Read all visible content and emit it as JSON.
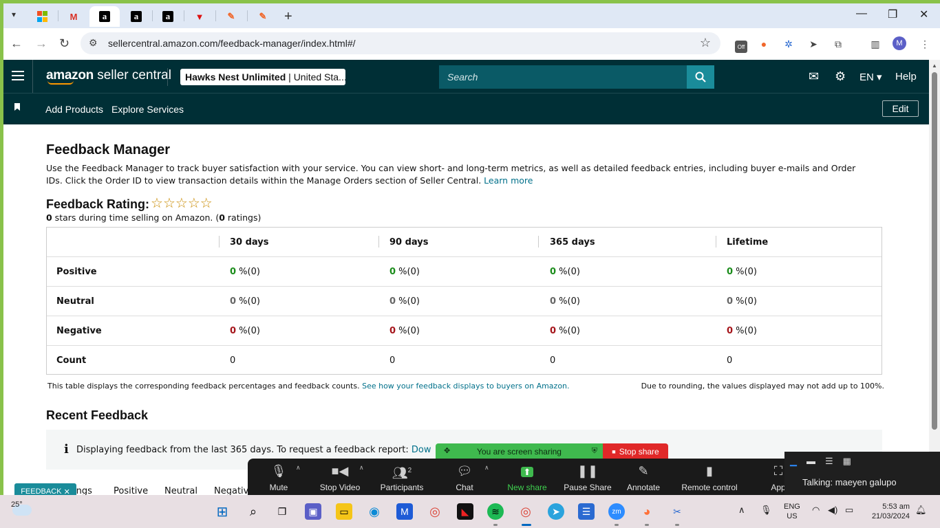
{
  "browser": {
    "url": "sellercentral.amazon.com/feedback-manager/index.html#/",
    "profile_initial": "M",
    "ext_off_label": "Off"
  },
  "header": {
    "logo_bold": "amazon",
    "logo_rest": " seller central",
    "account_name": "Hawks Nest Unlimited",
    "account_region": "United Sta...",
    "search_placeholder": "Search",
    "language": "EN",
    "help": "Help"
  },
  "subnav": {
    "links": [
      "Add Products",
      "Explore Services"
    ],
    "edit": "Edit"
  },
  "main": {
    "title": "Feedback Manager",
    "description": "Use the Feedback Manager to track buyer satisfaction with your service. You can view short- and long-term metrics, as well as detailed feedback entries, including buyer e-mails and Order IDs. Click the Order ID to view transaction details within the Manage Orders section of Seller Central.",
    "learn_more": "Learn more",
    "rating_title": "Feedback Rating:",
    "rating_stars": 0,
    "rating_sub_value": "0",
    "rating_sub_middle": " stars during time selling on Amazon. (",
    "rating_sub_count": "0",
    "rating_sub_end": " ratings)",
    "table": {
      "columns": [
        "30 days",
        "90 days",
        "365 days",
        "Lifetime"
      ],
      "rows": [
        {
          "label": "Positive",
          "type": "pos",
          "cells": [
            {
              "v": "0",
              "p": " %(0)"
            },
            {
              "v": "0",
              "p": " %(0)"
            },
            {
              "v": "0",
              "p": " %(0)"
            },
            {
              "v": "0",
              "p": " %(0)"
            }
          ]
        },
        {
          "label": "Neutral",
          "type": "neu",
          "cells": [
            {
              "v": "0",
              "p": " %(0)"
            },
            {
              "v": "0",
              "p": " %(0)"
            },
            {
              "v": "0",
              "p": " %(0)"
            },
            {
              "v": "0",
              "p": " %(0)"
            }
          ]
        },
        {
          "label": "Negative",
          "type": "neg",
          "cells": [
            {
              "v": "0",
              "p": " %(0)"
            },
            {
              "v": "0",
              "p": " %(0)"
            },
            {
              "v": "0",
              "p": " %(0)"
            },
            {
              "v": "0",
              "p": " %(0)"
            }
          ]
        },
        {
          "label": "Count",
          "type": "count",
          "cells": [
            {
              "v": "0",
              "p": ""
            },
            {
              "v": "0",
              "p": ""
            },
            {
              "v": "0",
              "p": ""
            },
            {
              "v": "0",
              "p": ""
            }
          ]
        }
      ]
    },
    "table_note": "This table displays the corresponding feedback percentages and feedback counts.",
    "table_note_link": "See how your feedback displays to buyers on Amazon.",
    "table_note_right": "Due to rounding, the values displayed may not add up to 100%.",
    "recent_title": "Recent Feedback",
    "info_text": "Displaying feedback from the last 365 days. To request a feedback report:",
    "info_link": "Dow",
    "tabs": [
      "ings",
      "Positive",
      "Neutral",
      "Negative"
    ],
    "feedback_button": "FEEDBACK"
  },
  "zoom": {
    "sharing": "You are screen sharing",
    "stop_share": "Stop share",
    "participants_count": "2",
    "items": [
      "Mute",
      "Stop Video",
      "Participants",
      "Chat",
      "New share",
      "Pause Share",
      "Annotate",
      "Remote control",
      "App"
    ],
    "talking": "Talking: maeyen galupo"
  },
  "taskbar": {
    "temp": "25°",
    "lang_top": "ENG",
    "lang_bottom": "US",
    "time": "5:53 am",
    "date": "21/03/2024"
  },
  "colors": {
    "nav_bg": "#002f36",
    "positive": "#1a8c1a",
    "negative": "#a5141a",
    "link": "#00708a",
    "accent": "#ff9900"
  }
}
